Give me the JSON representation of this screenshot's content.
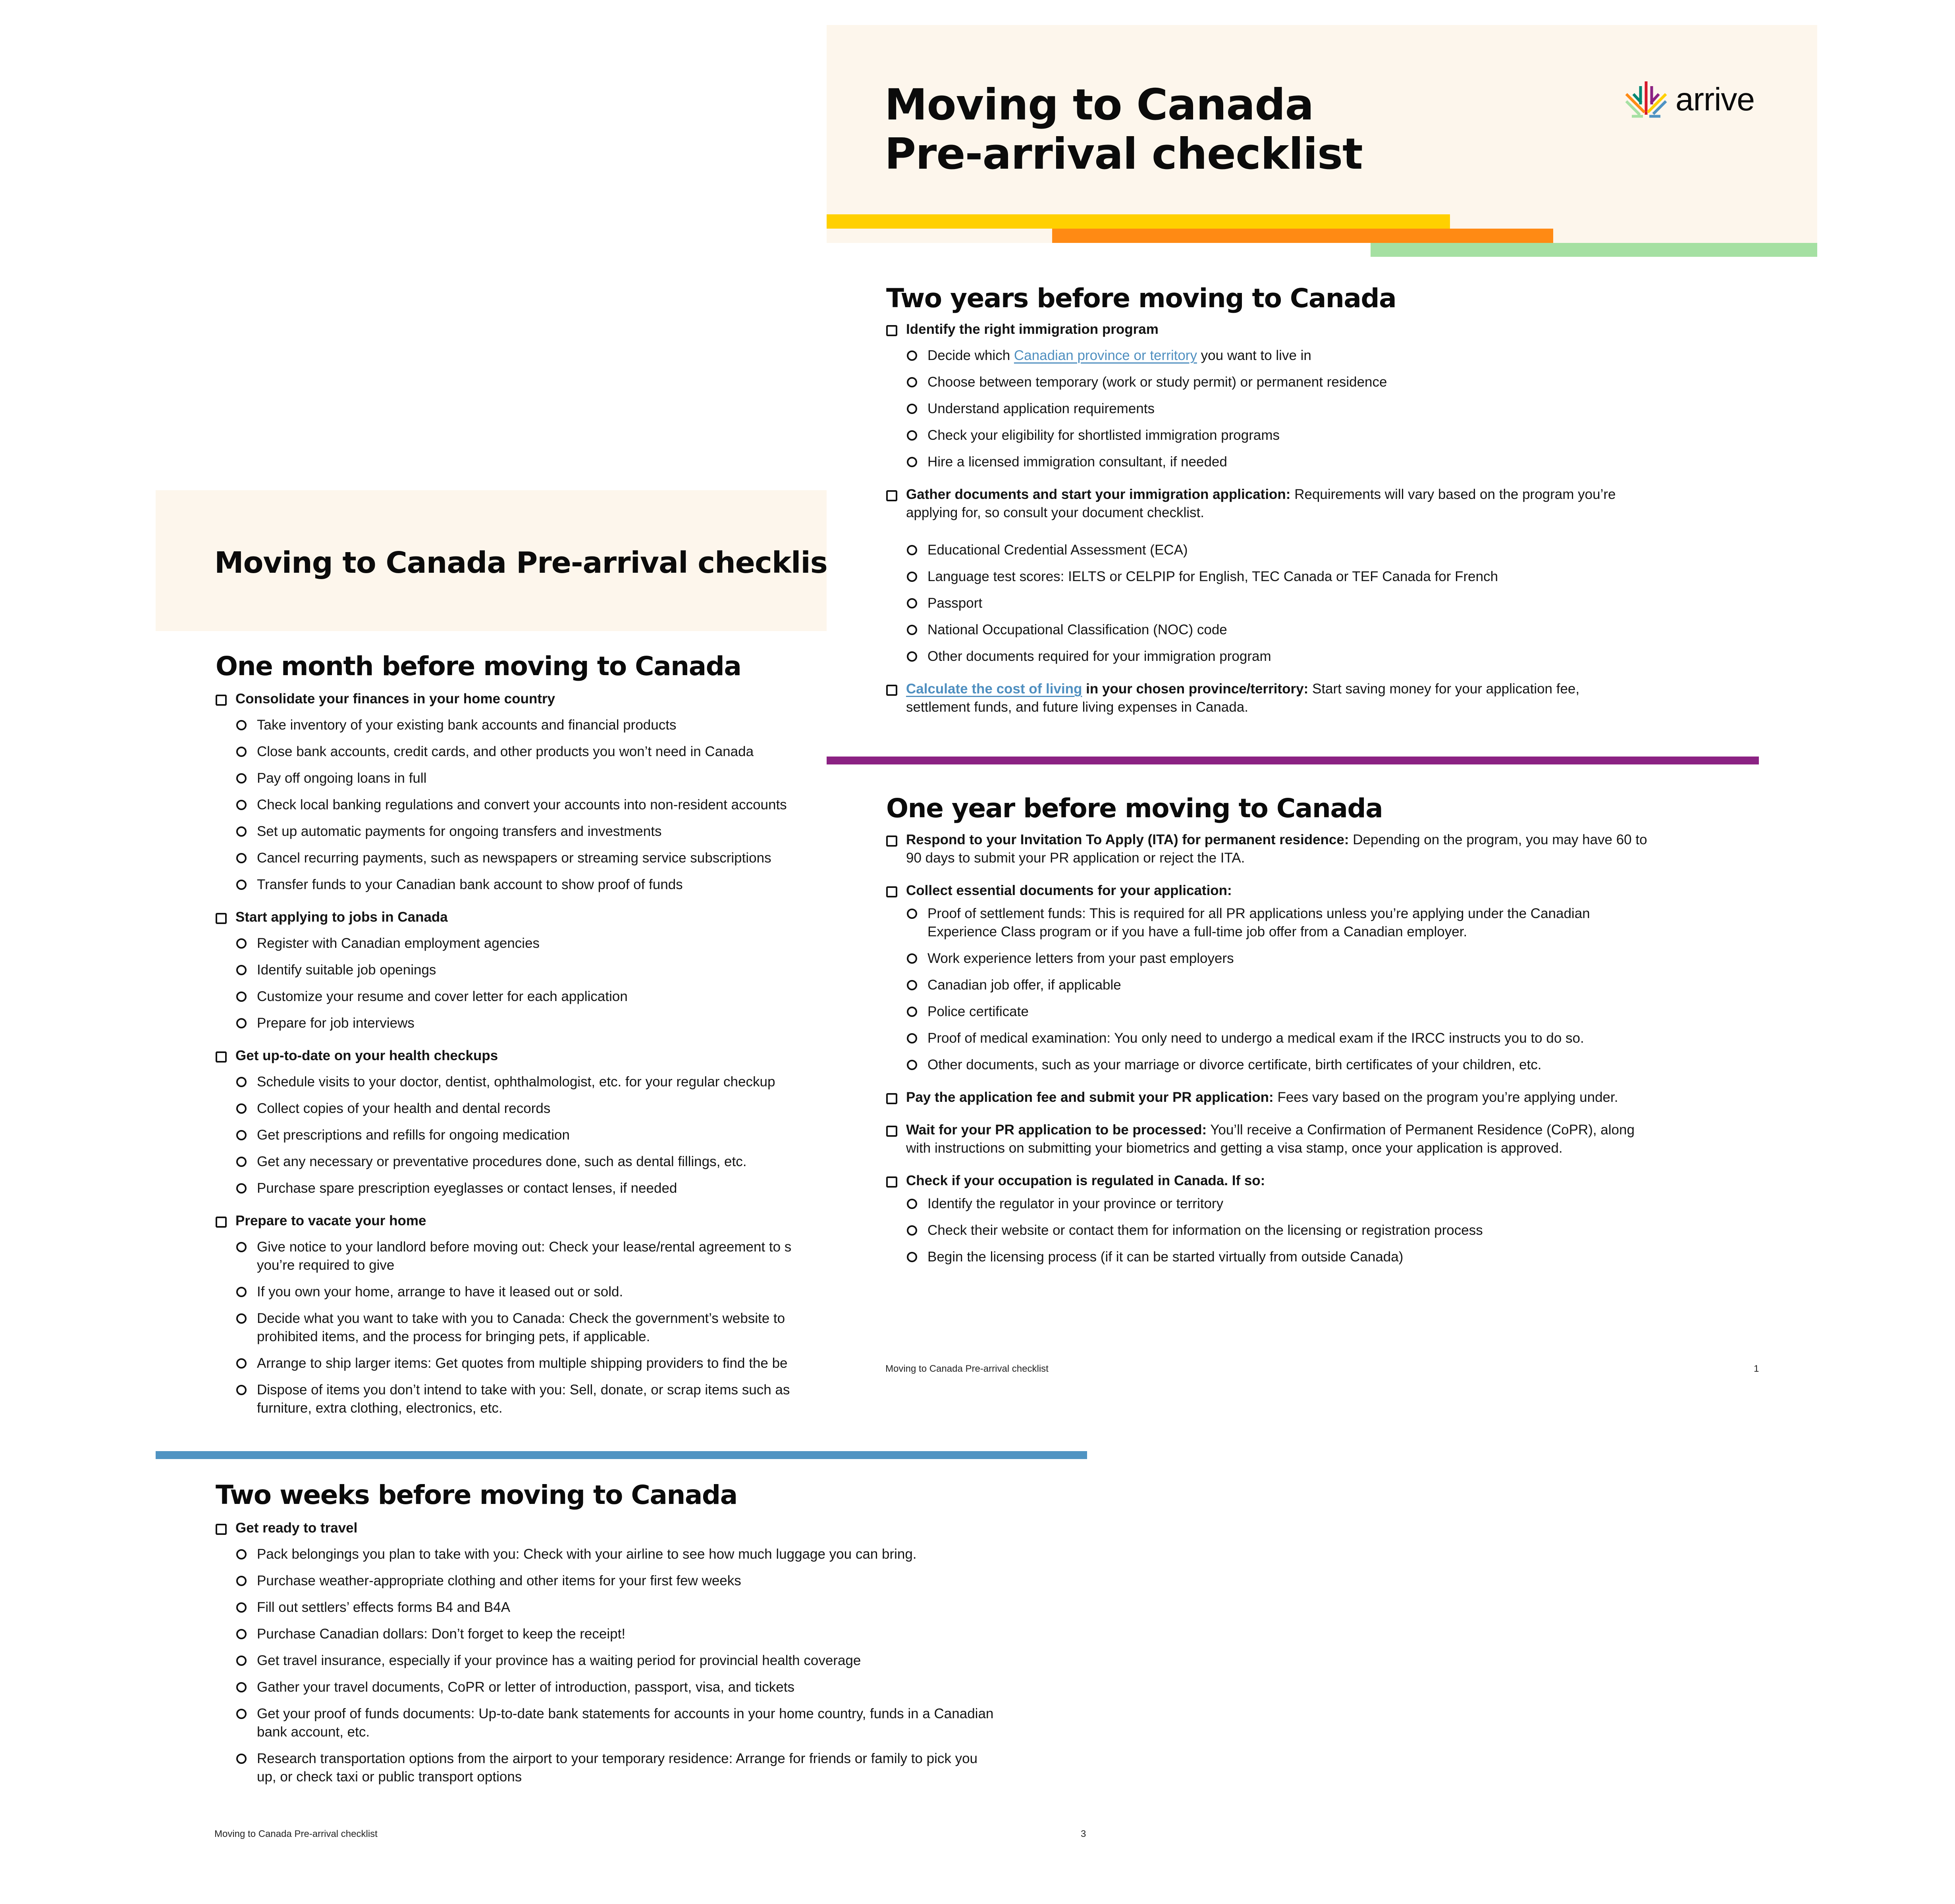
{
  "document": {
    "title_lines": [
      "Moving to Canada",
      "Pre-arrival checklist"
    ],
    "title_single": "Moving to Canada Pre-arrival checklist",
    "brand": {
      "name": "arrive",
      "icon": "maple-leaf-arrows-logo"
    },
    "colors": {
      "cream": "#fdf6ec",
      "yellow": "#ffd000",
      "orange": "#ff8a14",
      "green": "#a5e0a2",
      "purple": "#8b2283",
      "blue": "#4f93c2",
      "link": "#4f8fc0",
      "logo_red": "#d7182a",
      "logo_teal": "#008772",
      "logo_purple": "#8b2283"
    }
  },
  "page_right": {
    "footer_title": "Moving to Canada Pre-arrival checklist",
    "page_number": "1",
    "sections": [
      {
        "heading": "Two years before moving to Canada",
        "items": [
          {
            "lead": "Identify the right immigration program",
            "text": "",
            "subs": [
              {
                "pre": "Decide which ",
                "link": "Canadian province or territory",
                "post": " you want to live in"
              },
              {
                "text": "Choose between temporary (work or study permit) or permanent residence"
              },
              {
                "text": "Understand application requirements"
              },
              {
                "text": "Check your eligibility for shortlisted immigration programs"
              },
              {
                "text": "Hire a licensed immigration consultant, if needed"
              }
            ]
          },
          {
            "lead": "Gather documents and start your immigration application:",
            "text": " Requirements will vary based on the program you’re applying for, so consult your document checklist.",
            "subs": [
              {
                "text": "Educational Credential Assessment (ECA)"
              },
              {
                "text": "Language test scores: IELTS or CELPIP for English, TEC Canada or TEF Canada for French"
              },
              {
                "text": "Passport"
              },
              {
                "text": "National Occupational Classification (NOC) code"
              },
              {
                "text": "Other documents required for your immigration program"
              }
            ]
          },
          {
            "link": "Calculate the cost of living",
            "lead": " in your chosen province/territory:",
            "text": " Start saving money for your application fee, settlement funds, and future living expenses in Canada."
          }
        ]
      },
      {
        "heading": "One year before moving to Canada",
        "items": [
          {
            "lead": "Respond to your Invitation To Apply (ITA) for permanent residence:",
            "text": " Depending on the program, you may have 60 to 90 days to submit your PR application or reject the ITA."
          },
          {
            "lead": "Collect essential documents for your application:",
            "text": "",
            "subs": [
              {
                "text": "Proof of settlement funds: This is required for all PR applications unless you’re applying under the Canadian Experience Class program or if you have a full-time job offer from a Canadian employer."
              },
              {
                "text": "Work experience letters from your past employers"
              },
              {
                "text": "Canadian job offer, if applicable"
              },
              {
                "text": "Police certificate"
              },
              {
                "text": "Proof of medical examination: You only need to undergo a medical exam if the IRCC instructs you to do so."
              },
              {
                "text": "Other documents, such as your marriage or divorce certificate, birth certificates of your children, etc."
              }
            ]
          },
          {
            "lead": "Pay the application fee and submit your PR application:",
            "text": " Fees vary based on the program you’re applying under."
          },
          {
            "lead": "Wait for your PR application to be processed:",
            "text": " You’ll receive a Confirmation of Permanent Residence (CoPR), along with instructions on submitting your biometrics and getting a visa stamp, once your application is approved."
          },
          {
            "lead": "Check if your occupation is regulated in Canada. If so:",
            "text": "",
            "subs": [
              {
                "text": "Identify the regulator in your province or territory"
              },
              {
                "text": "Check their website or contact them for information on the licensing or registration process"
              },
              {
                "text": "Begin the licensing process (if it can be started virtually from outside Canada)"
              }
            ]
          }
        ]
      }
    ]
  },
  "page_left": {
    "footer_title": "Moving to Canada Pre-arrival checklist",
    "page_number": "3",
    "sections": [
      {
        "heading": "One month before moving to Canada",
        "items": [
          {
            "lead": "Consolidate your finances in your home country",
            "subs": [
              {
                "text": "Take inventory of your existing bank accounts and financial products"
              },
              {
                "text": "Close bank accounts, credit cards, and other products you won’t need in Canada"
              },
              {
                "text": "Pay off ongoing loans in full"
              },
              {
                "text": "Check local banking regulations and convert your accounts into non-resident accounts"
              },
              {
                "text": "Set up automatic payments for ongoing transfers and investments"
              },
              {
                "text": "Cancel recurring payments, such as newspapers or streaming service subscriptions"
              },
              {
                "text": "Transfer funds to your Canadian bank account to show proof of funds"
              }
            ]
          },
          {
            "lead": "Start applying to jobs in Canada",
            "subs": [
              {
                "text": "Register with Canadian employment agencies"
              },
              {
                "text": "Identify suitable job openings"
              },
              {
                "text": "Customize your resume and cover letter for each application"
              },
              {
                "text": "Prepare for job interviews"
              }
            ]
          },
          {
            "lead": "Get up-to-date on your health checkups",
            "subs": [
              {
                "text": "Schedule visits to your doctor, dentist, ophthalmologist, etc. for your regular checkup"
              },
              {
                "text": "Collect copies of your health and dental records"
              },
              {
                "text": "Get prescriptions and refills for ongoing medication"
              },
              {
                "text": "Get any necessary or preventative procedures done, such as dental fillings, etc."
              },
              {
                "text": "Purchase spare prescription eyeglasses or contact lenses, if needed"
              }
            ]
          },
          {
            "lead": "Prepare to vacate your home",
            "subs": [
              {
                "text": "Give notice to your landlord before moving out: Check your lease/rental agreement to s",
                "text2": "you’re required to give"
              },
              {
                "text": "If you own your home, arrange to have it leased out or sold."
              },
              {
                "text": "Decide what you want to take with you to Canada: Check the government’s website to",
                "text2": "prohibited items, and the process for bringing pets, if applicable."
              },
              {
                "text": "Arrange to ship larger items: Get quotes from multiple shipping providers to find the be"
              },
              {
                "text": "Dispose of items you don’t intend to take with you: Sell, donate, or scrap items such as",
                "text2": "furniture, extra clothing, electronics, etc."
              }
            ]
          }
        ]
      },
      {
        "heading": "Two weeks before moving to Canada",
        "items": [
          {
            "lead": "Get ready to travel",
            "subs": [
              {
                "text": "Pack belongings you plan to take with you: Check with your airline to see how much luggage you can bring."
              },
              {
                "text": "Purchase weather-appropriate clothing and other items for your first few weeks"
              },
              {
                "text": "Fill out settlers’ effects forms B4 and B4A"
              },
              {
                "text": "Purchase Canadian dollars: Don’t forget to keep the receipt!"
              },
              {
                "text": "Get travel insurance, especially if your province has a waiting period for provincial health coverage"
              },
              {
                "text": "Gather your travel documents, CoPR or letter of introduction, passport, visa, and tickets"
              },
              {
                "text": "Get your proof of funds documents: Up-to-date bank statements for accounts in your home country, funds in a Canadian bank account, etc."
              },
              {
                "text": "Research transportation options from the airport to your temporary residence: Arrange for friends or family to pick you up, or check taxi or public transport options"
              }
            ]
          }
        ]
      }
    ]
  }
}
